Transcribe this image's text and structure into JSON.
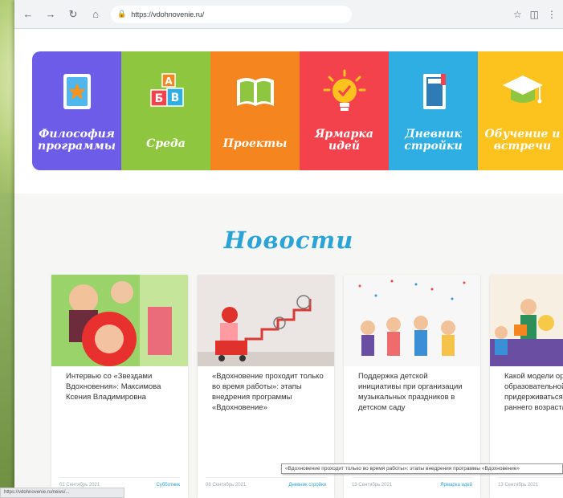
{
  "browser": {
    "url": "https://vdohnovenie.ru/",
    "back_icon": "arrow-left-icon",
    "forward_icon": "arrow-right-icon",
    "reload_icon": "reload-icon",
    "home_icon": "home-icon",
    "lock_icon": "lock-icon"
  },
  "menu": [
    {
      "label": "Философия программы",
      "icon": "star-document-icon",
      "color": "#6c5ce7"
    },
    {
      "label": "Среда",
      "icon": "alphabet-blocks-icon",
      "color": "#8fc63f"
    },
    {
      "label": "Проекты",
      "icon": "open-book-icon",
      "color": "#f5851f"
    },
    {
      "label": "Ярмарка идей",
      "icon": "lightbulb-icon",
      "color": "#f3424c"
    },
    {
      "label": "Дневник стройки",
      "icon": "diary-icon",
      "color": "#2eaee3"
    },
    {
      "label": "Обучение и встречи",
      "icon": "graduation-cap-icon",
      "color": "#fcc21e"
    }
  ],
  "news": {
    "heading": "Новости",
    "cards": [
      {
        "title": "Интервью со «Звездами Вдохновения»: Максимова Ксения Владимировна",
        "date": "01 Сентябрь 2021",
        "category": "Субботник"
      },
      {
        "title": "«Вдохновение проходит только во время работы»: этапы внедрения программы «Вдохновение»",
        "date": "08 Сентябрь 2021",
        "category": "Дневник стройки"
      },
      {
        "title": "Поддержка детской инициативы при организации музыкальных праздников в детском саду",
        "date": "13 Сентябрь 2021",
        "category": "Ярмарка идей"
      },
      {
        "title": "Какой модели организации образовательной деятельности придерживаться в группах раннего возраста?",
        "date": "13 Сентябрь 2021",
        "category": ""
      }
    ]
  },
  "tooltip": "«Вдохновение проходит только во время работы»: этапы внедрения программы «Вдохновение»",
  "status": "https://vdohnovenie.ru/news/..."
}
